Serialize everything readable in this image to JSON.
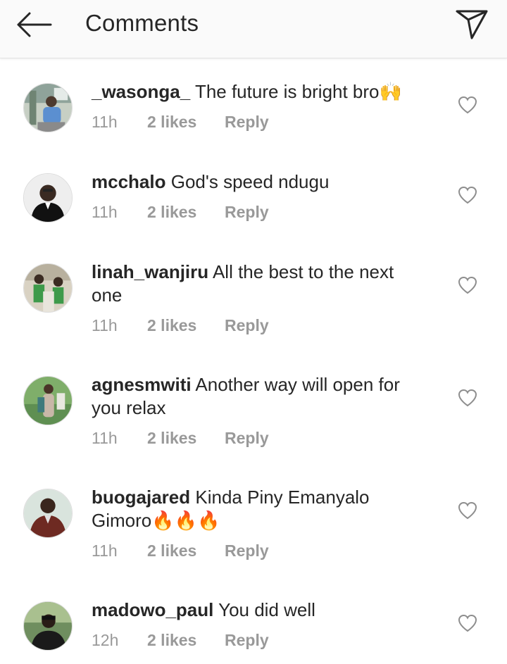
{
  "header": {
    "title": "Comments",
    "back_icon": "arrow-left-icon",
    "share_icon": "paper-plane-icon"
  },
  "comments": [
    {
      "username": "_wasonga_",
      "text": "The future is bright bro🙌",
      "time": "11h",
      "likes": "2 likes",
      "reply": "Reply"
    },
    {
      "username": "mcchalo",
      "text": "God's speed ndugu",
      "time": "11h",
      "likes": "2 likes",
      "reply": "Reply"
    },
    {
      "username": "linah_wanjiru",
      "text": "All the best to the next one",
      "time": "11h",
      "likes": "2 likes",
      "reply": "Reply"
    },
    {
      "username": "agnesmwiti",
      "text": "Another way will open for you relax",
      "time": "11h",
      "likes": "2 likes",
      "reply": "Reply"
    },
    {
      "username": "buogajared",
      "text": "Kinda Piny Emanyalo Gimoro🔥🔥🔥",
      "time": "11h",
      "likes": "2 likes",
      "reply": "Reply"
    },
    {
      "username": "madowo_paul",
      "text": "You did well",
      "time": "12h",
      "likes": "2 likes",
      "reply": "Reply"
    }
  ]
}
